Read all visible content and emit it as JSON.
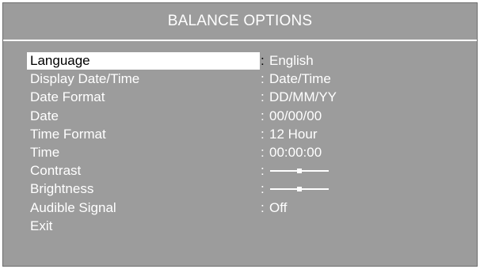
{
  "header": {
    "title": "BALANCE OPTIONS"
  },
  "menu": {
    "separator": ":",
    "items": [
      {
        "label": "Language",
        "value": "English",
        "selected": true
      },
      {
        "label": "Display Date/Time",
        "value": "Date/Time"
      },
      {
        "label": "Date Format",
        "value": "DD/MM/YY"
      },
      {
        "label": "Date",
        "value": "00/00/00"
      },
      {
        "label": "Time Format",
        "value": "12 Hour"
      },
      {
        "label": "Time",
        "value": "00:00:00"
      },
      {
        "label": "Contrast",
        "slider_level": 0.5
      },
      {
        "label": "Brightness",
        "slider_level": 0.5
      },
      {
        "label": "Audible Signal",
        "value": "Off"
      },
      {
        "label": "Exit"
      }
    ]
  },
  "colors": {
    "background": "#9c9c9c",
    "text": "#ffffff",
    "highlight": "#ffffff"
  }
}
